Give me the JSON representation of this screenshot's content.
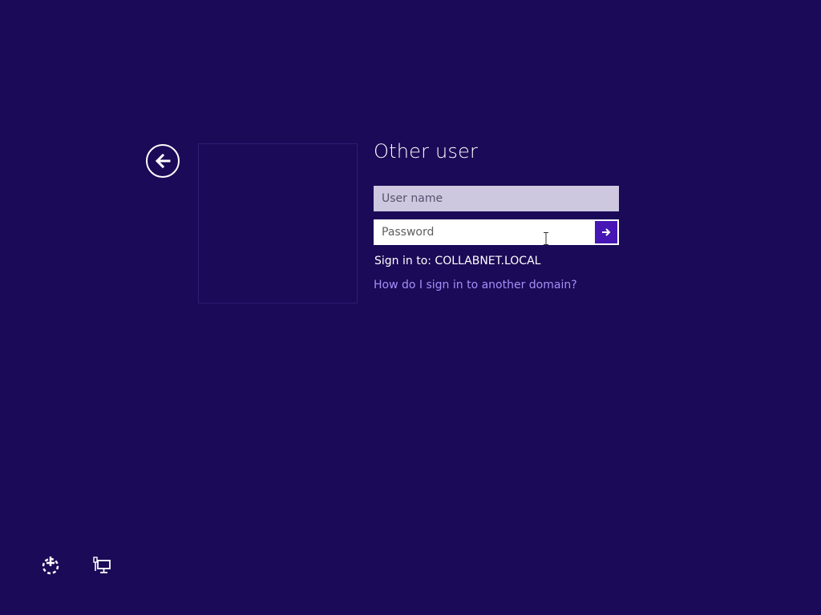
{
  "login": {
    "title": "Other user",
    "username_placeholder": "User name",
    "password_placeholder": "Password",
    "signin_to": "Sign in to: COLLABNET.LOCAL",
    "domain_help_link": "How do I sign in to another domain?"
  },
  "icons": {
    "back": "back-arrow-icon",
    "submit": "arrow-right-icon",
    "ease_of_access": "ease-of-access-icon",
    "network": "network-icon"
  },
  "colors": {
    "background": "#1b0a57",
    "accent": "#4617b4",
    "link": "#a68ef7",
    "username_field_bg": "#cdc8e0"
  }
}
